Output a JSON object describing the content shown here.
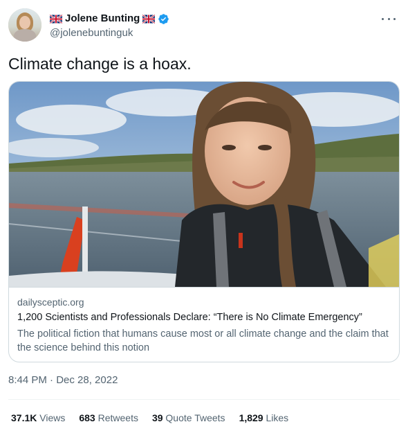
{
  "author": {
    "display_name": "Jolene Bunting",
    "handle": "@jolenebuntinguk",
    "name_emoji": "uk-flag-icon",
    "verified_icon": "verified-badge-icon",
    "verified_color": "#1d9bf0"
  },
  "tweet": {
    "text": "Climate change is a hoax.",
    "timestamp": "8:44 PM · Dec 28, 2022"
  },
  "link_card": {
    "domain": "dailysceptic.org",
    "title": "1,200 Scientists and Professionals Declare: “There is No Climate Emergency”",
    "description": "The political fiction that humans cause most or all climate change and the claim that the science behind this notion"
  },
  "stats": {
    "views_value": "37.1K",
    "views_label": "Views",
    "retweets_value": "683",
    "retweets_label": "Retweets",
    "quotes_value": "39",
    "quotes_label": "Quote Tweets",
    "likes_value": "1,829",
    "likes_label": "Likes"
  },
  "colors": {
    "text_primary": "#0f1419",
    "text_secondary": "#536471",
    "border": "#cfd9de"
  }
}
